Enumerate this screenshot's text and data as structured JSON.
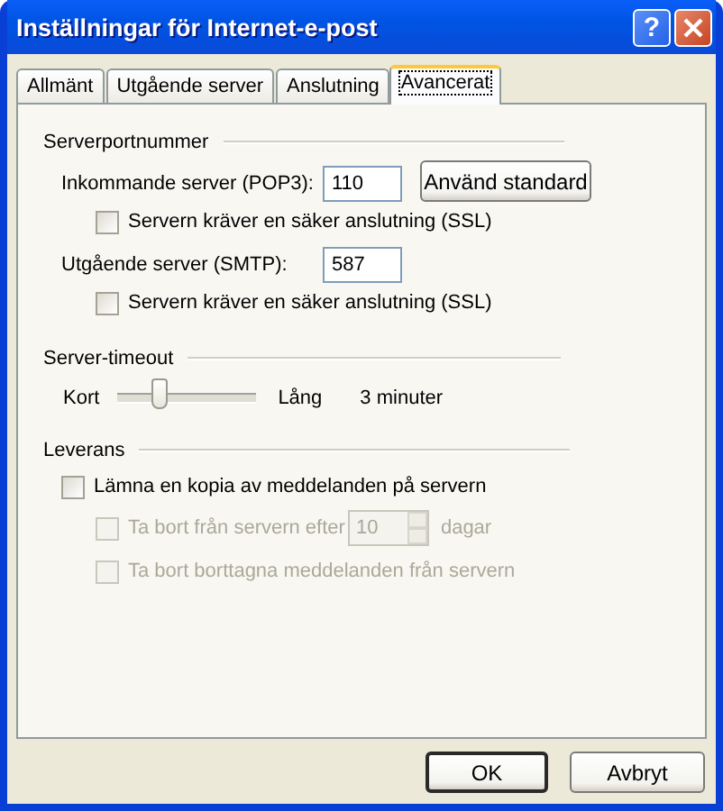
{
  "window": {
    "title": "Inställningar för Internet-e-post",
    "help": "?"
  },
  "tabs": [
    {
      "label": "Allmänt",
      "selected": false
    },
    {
      "label": "Utgående server",
      "selected": false
    },
    {
      "label": "Anslutning",
      "selected": false
    },
    {
      "label": "Avancerat",
      "selected": true
    }
  ],
  "port_group": {
    "title": "Serverportnummer",
    "incoming": {
      "label": "Inkommande server (POP3):",
      "value": "110",
      "button": "Använd standard",
      "ssl": {
        "label": "Servern kräver en säker anslutning (SSL)",
        "checked": false
      }
    },
    "outgoing": {
      "label": "Utgående server (SMTP):",
      "value": "587",
      "ssl": {
        "label": "Servern kräver en säker anslutning (SSL)",
        "checked": false
      }
    }
  },
  "timeout_group": {
    "title": "Server-timeout",
    "min_label": "Kort",
    "max_label": "Lång",
    "level": 0.3,
    "reading": "3 minuter"
  },
  "delivery_group": {
    "title": "Leverans",
    "options": [
      {
        "label": "Lämna en kopia av meddelanden på servern",
        "checked": false,
        "disabled": false,
        "children": [
          {
            "label": "Ta bort från servern efter",
            "checked": false,
            "disabled": true,
            "spin_value": "10",
            "unit": "dagar"
          },
          {
            "label": "Ta bort borttagna meddelanden från servern",
            "checked": false,
            "disabled": true
          }
        ]
      }
    ]
  },
  "buttons": [
    {
      "label": "OK",
      "default": true
    },
    {
      "label": "Avbryt",
      "default": false
    }
  ]
}
